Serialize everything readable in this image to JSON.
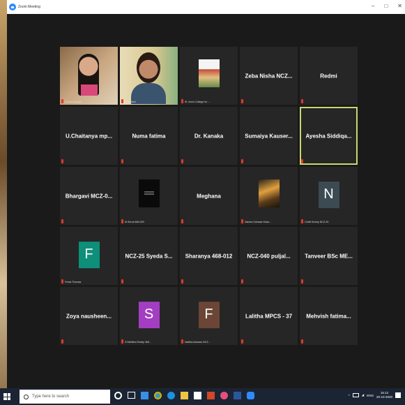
{
  "window": {
    "title": "Zoom Meeting",
    "controls": [
      "–",
      "□",
      "✕"
    ]
  },
  "participants": [
    {
      "name": "Charmi Biswas",
      "kind": "video1"
    },
    {
      "name": "Sree Vani",
      "kind": "video2"
    },
    {
      "name": "St. Ann's College for ...",
      "kind": "img-stann"
    },
    {
      "name": "Zeba Nisha NCZ...",
      "kind": "text"
    },
    {
      "name": "Redmi",
      "kind": "text"
    },
    {
      "name": "U.Chaitanya mp...",
      "kind": "text"
    },
    {
      "name": "Numa fatima",
      "kind": "text"
    },
    {
      "name": "Dr. Kanaka",
      "kind": "text"
    },
    {
      "name": "Sumaiya Kauser...",
      "kind": "text"
    },
    {
      "name": "Ayesha Siddiqa...",
      "kind": "text",
      "active": true
    },
    {
      "name": "Bhargavi MCZ-0...",
      "kind": "text"
    },
    {
      "name": "M Shruti 468-009",
      "kind": "img-dark"
    },
    {
      "name": "Meghana",
      "kind": "text"
    },
    {
      "name": "Saleha Gulnaaz Khan...",
      "kind": "img-sunset"
    },
    {
      "name": "Chelli Keviny NCZ-30",
      "kind": "avatar",
      "initial": "N",
      "color": "#3c4a52"
    },
    {
      "name": "Freda Thomas",
      "kind": "avatar",
      "initial": "F",
      "color": "#0e8f7a"
    },
    {
      "name": "NCZ-25 Syeda S...",
      "kind": "text"
    },
    {
      "name": "Sharanya 468-012",
      "kind": "text"
    },
    {
      "name": "NCZ-040 puljal...",
      "kind": "text"
    },
    {
      "name": "Tanveer BSc ME...",
      "kind": "text"
    },
    {
      "name": "Zoya nausheen...",
      "kind": "text"
    },
    {
      "name": "S.Nikhitha Reddy 468...",
      "kind": "avatar",
      "initial": "S",
      "color": "#a33ec2"
    },
    {
      "name": "Nabiha khanam NCZ...",
      "kind": "avatar",
      "initial": "F",
      "color": "#6b4536"
    },
    {
      "name": "Lalitha MPCS - 37",
      "kind": "text"
    },
    {
      "name": "Mehvish fatima...",
      "kind": "text"
    }
  ],
  "taskbar": {
    "search_placeholder": "Type here to search",
    "lang": "ENG",
    "time": "15:12",
    "date": "20-10-2020"
  }
}
